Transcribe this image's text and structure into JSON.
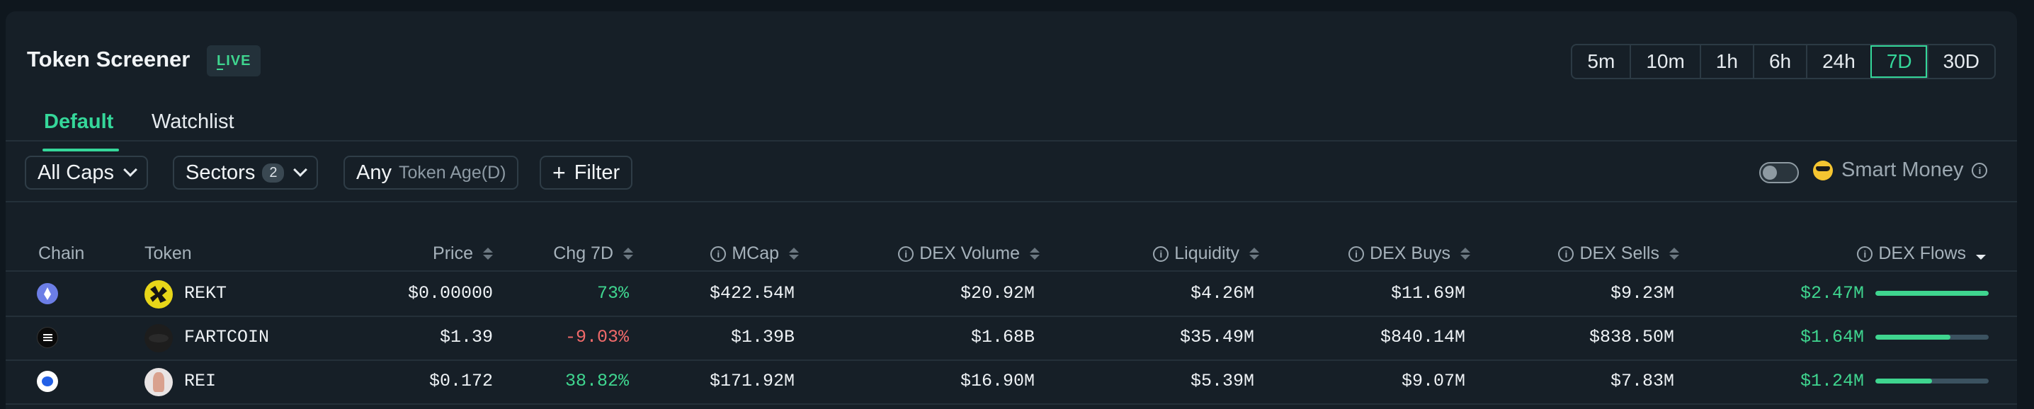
{
  "header": {
    "title": "Token Screener",
    "live_badge": "LIVE",
    "timeframes": [
      "5m",
      "10m",
      "1h",
      "6h",
      "24h",
      "7D",
      "30D"
    ],
    "active_timeframe": "7D"
  },
  "tabs": [
    {
      "label": "Default",
      "active": true
    },
    {
      "label": "Watchlist",
      "active": false
    }
  ],
  "filters": {
    "caps": "All Caps",
    "sectors": "Sectors",
    "sectors_count": "2",
    "age_value": "Any",
    "age_label": "Token Age(D)",
    "filter_label": "Filter",
    "smart_money_label": "Smart Money",
    "smart_money_on": false
  },
  "table": {
    "columns": {
      "chain": "Chain",
      "token": "Token",
      "price": "Price",
      "chg": "Chg 7D",
      "mcap": "MCap",
      "dex_volume": "DEX Volume",
      "liquidity": "Liquidity",
      "dex_buys": "DEX Buys",
      "dex_sells": "DEX Sells",
      "dex_flows": "DEX Flows"
    },
    "rows": [
      {
        "chain": "ethereum-icon",
        "token": "REKT",
        "price": "$0.00000",
        "chg": "73%",
        "chg_dir": "pos",
        "mcap": "$422.54M",
        "dex_volume": "$20.92M",
        "liquidity": "$4.26M",
        "dex_buys": "$11.69M",
        "dex_sells": "$9.23M",
        "dex_flows": "$2.47M",
        "flow_fraction": 1.0
      },
      {
        "chain": "solana-icon",
        "token": "FARTCOIN",
        "price": "$1.39",
        "chg": "-9.03%",
        "chg_dir": "neg",
        "mcap": "$1.39B",
        "dex_volume": "$1.68B",
        "liquidity": "$35.49M",
        "dex_buys": "$840.14M",
        "dex_sells": "$838.50M",
        "dex_flows": "$1.64M",
        "flow_fraction": 0.66
      },
      {
        "chain": "base-icon",
        "token": "REI",
        "price": "$0.172",
        "chg": "38.82%",
        "chg_dir": "pos",
        "mcap": "$171.92M",
        "dex_volume": "$16.90M",
        "liquidity": "$5.39M",
        "dex_buys": "$9.07M",
        "dex_sells": "$7.83M",
        "dex_flows": "$1.24M",
        "flow_fraction": 0.5
      }
    ]
  },
  "colors": {
    "accent": "#35d79a",
    "positive": "#3fd58f",
    "negative": "#f06a6a",
    "background": "#161f27"
  }
}
